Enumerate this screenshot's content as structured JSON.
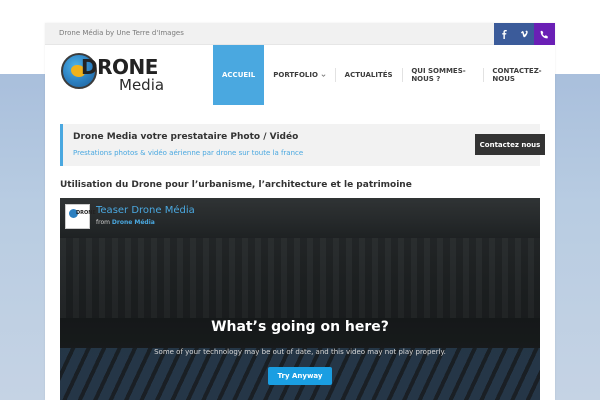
{
  "topbar": {
    "tagline": "Drone Média by Une Terre d'Images",
    "social": [
      {
        "icon": "facebook-icon",
        "color": "#3b5b9a"
      },
      {
        "icon": "vimeo-icon",
        "color": "#3b5b9a"
      },
      {
        "icon": "phone-icon",
        "color": "#6a1fb5"
      }
    ]
  },
  "logo": {
    "word1": "DRONE",
    "word2": "Media"
  },
  "nav": {
    "items": [
      {
        "label": "ACCUEIL",
        "active": true
      },
      {
        "label": "PORTFOLIO",
        "has_dropdown": true
      },
      {
        "label": "ACTUALITÉS"
      },
      {
        "label": "QUI SOMMES-NOUS ?"
      },
      {
        "label": "CONTACTEZ-NOUS"
      }
    ]
  },
  "promo": {
    "title": "Drone Media votre prestataire Photo / Vidéo",
    "subtitle": "Prestations photos & vidéo aérienne par drone sur toute la france",
    "button": "Contactez nous"
  },
  "section": {
    "title": "Utilisation du Drone pour l’urbanisme, l’architecture et le patrimoine"
  },
  "video": {
    "title": "Teaser Drone Média",
    "from_prefix": "from",
    "from_author": "Drone Média",
    "heading": "What’s going on here?",
    "message": "Some of your technology may be out of date, and this video may not play properly.",
    "button": "Try Anyway"
  },
  "colors": {
    "accent": "#4aa8e0",
    "dark_button": "#333333",
    "video_button": "#1a9ee2"
  }
}
